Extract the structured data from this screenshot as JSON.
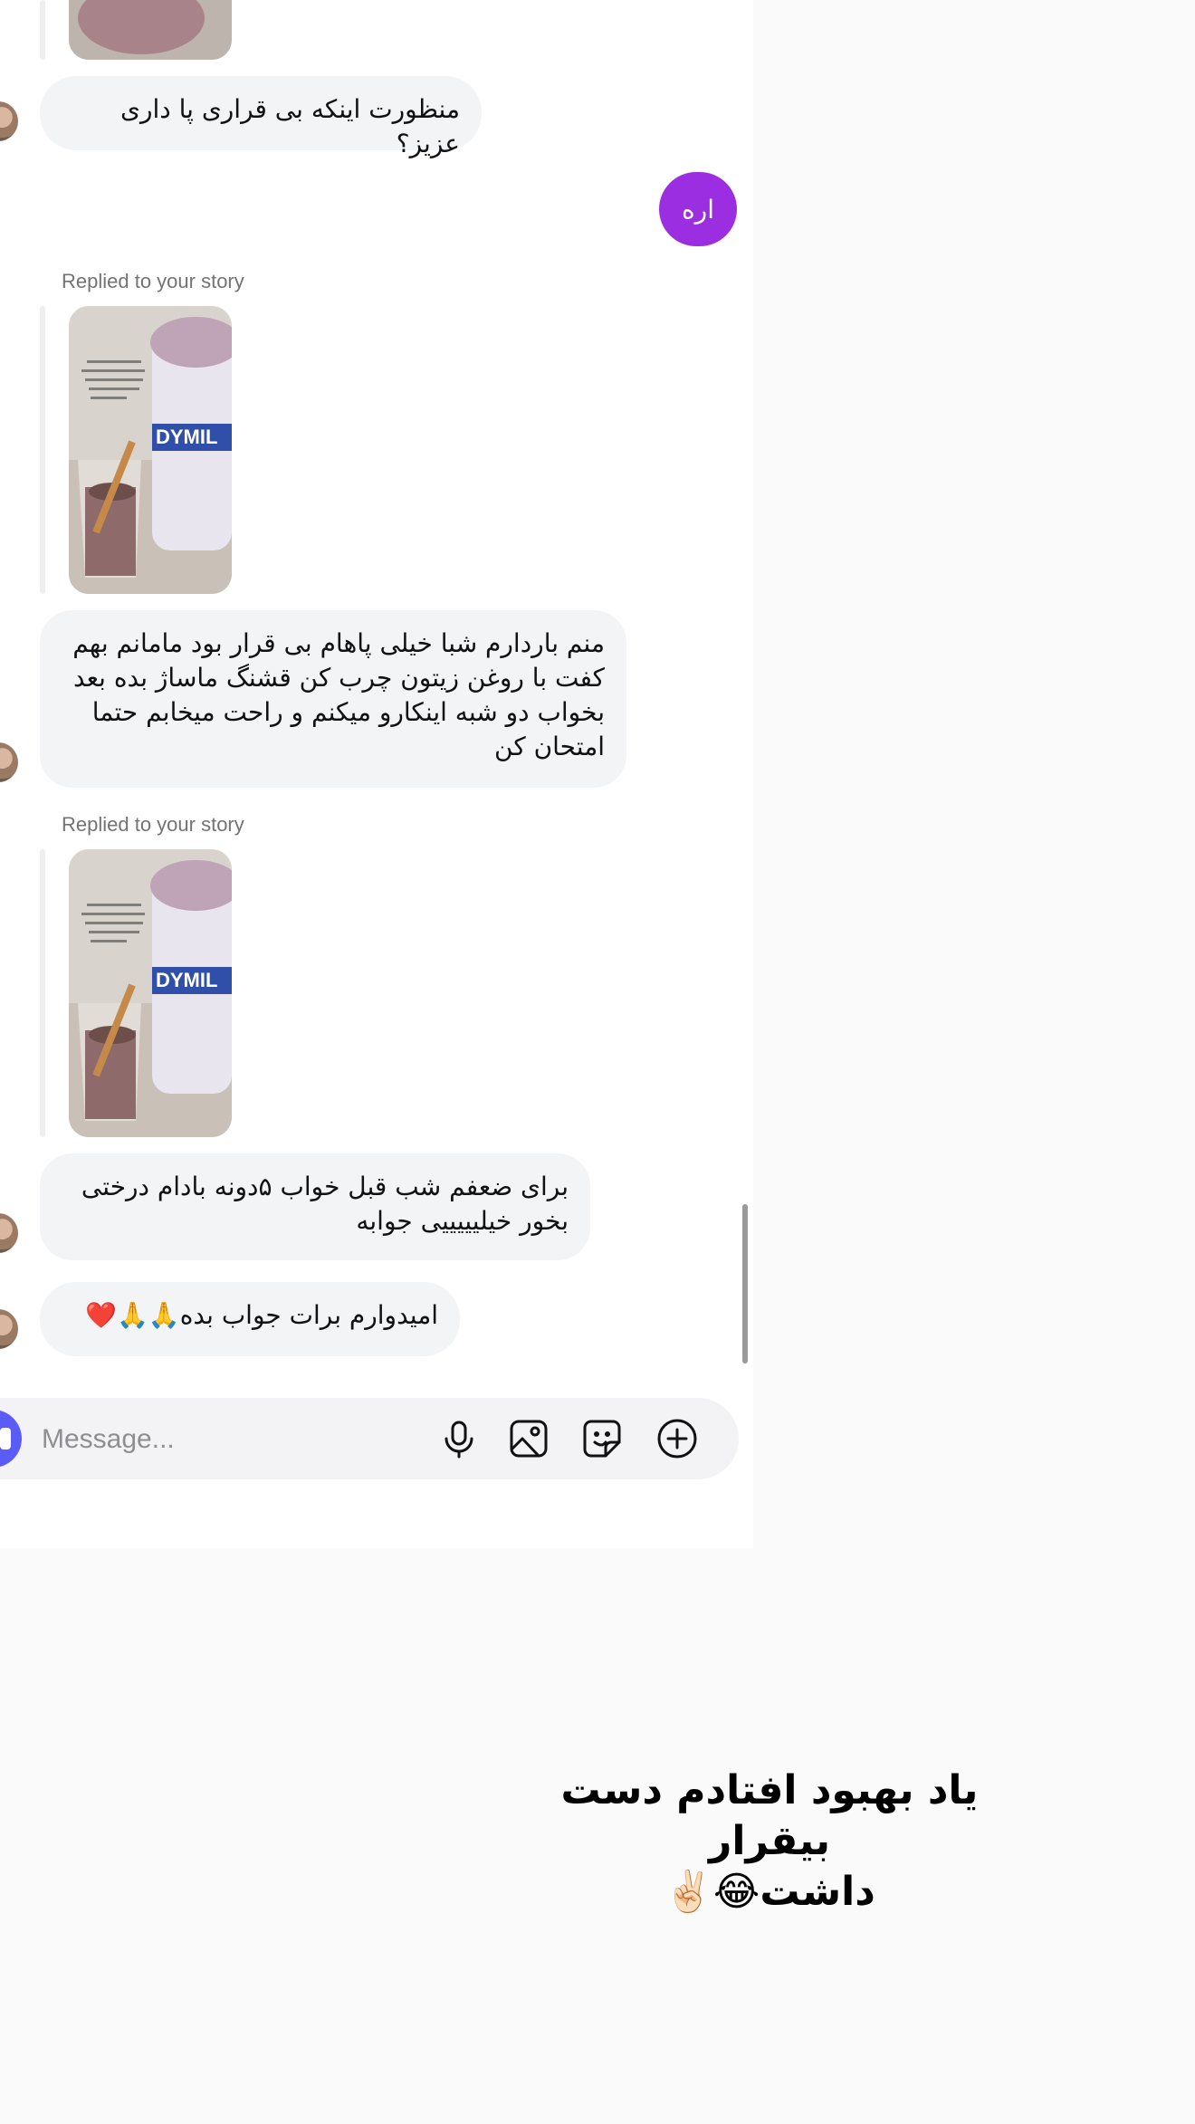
{
  "thread": {
    "messages": [
      {
        "type": "incoming",
        "text": "منظورت اینکه بی قراری پا داری عزیز؟"
      },
      {
        "type": "outgoing",
        "text": "اره"
      },
      {
        "type": "story_reply_label",
        "text": "Replied to your story"
      },
      {
        "type": "incoming",
        "lines": [
          "منم باردارم شبا خیلی پاهام بی قرار بود مامانم بهم",
          "کفت با روغن زیتون چرب کن قشنگ ماساژ بده بعد",
          "بخواب دو شبه اینکارو میکنم و راحت میخابم حتما",
          "امتحان کن"
        ]
      },
      {
        "type": "story_reply_label",
        "text": "Replied to your story"
      },
      {
        "type": "incoming",
        "lines": [
          "برای ضعفم شب قبل خواب ۵دونه بادام درختی",
          "بخور خیلیییییی جوابه"
        ]
      },
      {
        "type": "incoming",
        "text": "امیدوارم برات جواب بده🙏🙏❤️"
      }
    ],
    "story_thumbnail_text": "DYMIL"
  },
  "composer": {
    "placeholder": "Message...",
    "icons": [
      "microphone-icon",
      "image-icon",
      "sticker-icon",
      "plus-circle-icon"
    ]
  },
  "caption": {
    "line1": "یاد بهبود افتادم دست بیقرار",
    "line2": "داشت😂✌🏻"
  },
  "colors": {
    "outgoing_bubble": "#9b2ee0",
    "incoming_bubble": "#f3f4f6",
    "camera_button": "#5b5bf6"
  }
}
